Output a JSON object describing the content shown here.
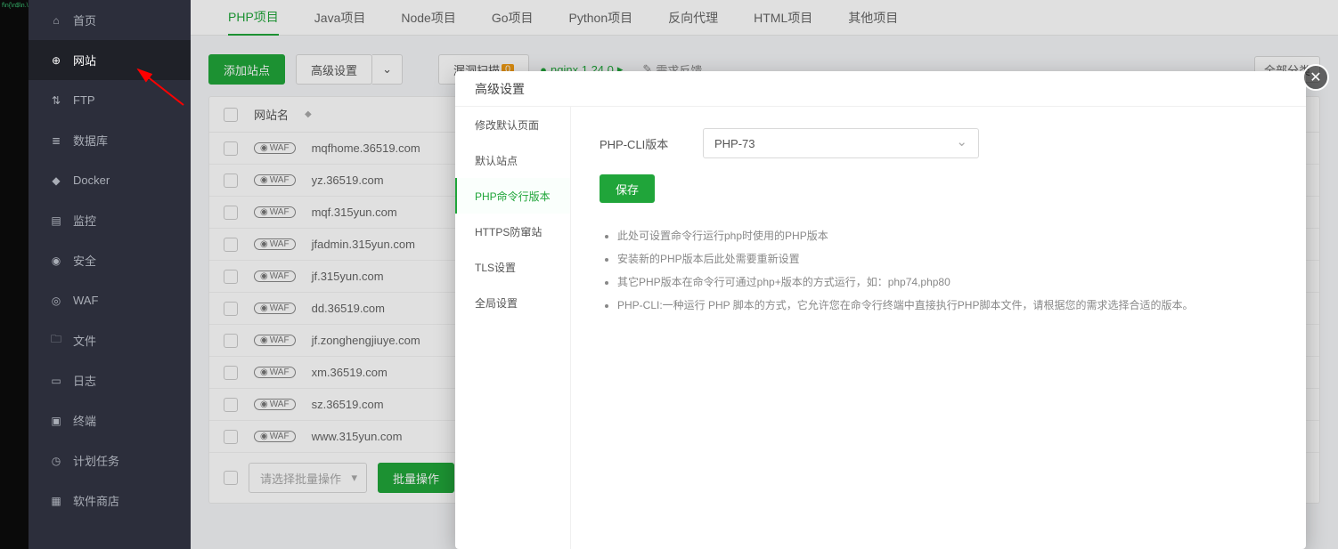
{
  "sidebar": {
    "items": [
      {
        "label": "首页"
      },
      {
        "label": "网站"
      },
      {
        "label": "FTP"
      },
      {
        "label": "数据库"
      },
      {
        "label": "Docker"
      },
      {
        "label": "监控"
      },
      {
        "label": "安全"
      },
      {
        "label": "WAF"
      },
      {
        "label": "文件"
      },
      {
        "label": "日志"
      },
      {
        "label": "终端"
      },
      {
        "label": "计划任务"
      },
      {
        "label": "软件商店"
      }
    ],
    "active_index": 1
  },
  "tabs": {
    "items": [
      "PHP项目",
      "Java项目",
      "Node项目",
      "Go项目",
      "Python项目",
      "反向代理",
      "HTML项目",
      "其他项目"
    ],
    "active_index": 0
  },
  "toolbar": {
    "add_site": "添加站点",
    "advanced": "高级设置",
    "vuln_scan": "漏洞扫描",
    "vuln_badge": "0",
    "nginx_text": "nginx 1.24.0",
    "feedback": "需求反馈",
    "category_all": "全部分类"
  },
  "table": {
    "header_sitename": "网站名",
    "rows": [
      {
        "name": "mqfhome.36519.com"
      },
      {
        "name": "yz.36519.com"
      },
      {
        "name": "mqf.315yun.com"
      },
      {
        "name": "jfadmin.315yun.com"
      },
      {
        "name": "jf.315yun.com"
      },
      {
        "name": "dd.36519.com"
      },
      {
        "name": "jf.zonghengjiuye.com"
      },
      {
        "name": "xm.36519.com"
      },
      {
        "name": "sz.36519.com"
      },
      {
        "name": "www.315yun.com"
      }
    ],
    "batch_placeholder": "请选择批量操作",
    "batch_btn": "批量操作"
  },
  "modal": {
    "title": "高级设置",
    "nav": [
      "修改默认页面",
      "默认站点",
      "PHP命令行版本",
      "HTTPS防窜站",
      "TLS设置",
      "全局设置"
    ],
    "nav_active": 2,
    "form_label": "PHP-CLI版本",
    "select_value": "PHP-73",
    "save": "保存",
    "help": [
      "此处可设置命令行运行php时使用的PHP版本",
      "安装新的PHP版本后此处需要重新设置",
      "其它PHP版本在命令行可通过php+版本的方式运行，如：php74,php80",
      "PHP-CLI:一种运行 PHP 脚本的方式，它允许您在命令行终端中直接执行PHP脚本文件，请根据您的需求选择合适的版本。"
    ]
  }
}
